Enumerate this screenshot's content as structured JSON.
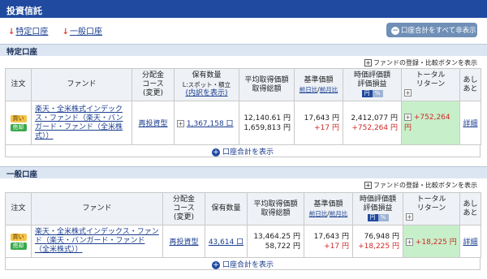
{
  "header": {
    "title": "投資信託"
  },
  "links": [
    {
      "label": "特定口座"
    },
    {
      "label": "一般口座"
    }
  ],
  "hide_all_button": {
    "label": "口座合計をすべて非表示"
  },
  "register_text": "ファンドの登録・比較ボタンを表示",
  "headers": {
    "order": "注文",
    "fund": "ファンド",
    "dist_1": "分配金",
    "dist_2": "コース",
    "dist_3": "(変更)",
    "qty_1": "保有数量",
    "qty_2": "L:スポット・積立",
    "qty_3": "(内訳を表示)",
    "qty_plain": "保有数量",
    "avg_1": "平均取得価額",
    "avg_2": "取得総額",
    "base_1": "基準価額",
    "base_prev_day": "前日比",
    "base_sep": "/",
    "base_prev_month": "前月比",
    "eval_1": "時価評価額",
    "eval_2": "評価損益",
    "yen_toggle": "円",
    "pct_toggle": "%",
    "total_1": "トータル",
    "total_2": "リターン",
    "ashi_1": "あし",
    "ashi_2": "あと"
  },
  "sections": [
    {
      "title": "特定口座",
      "row": {
        "buy_badge": "買い",
        "sell_badge": "売却",
        "fund_name": "楽天・全米株式インデックス・ファンド（楽天・バンガード・ファンド（全米株式））",
        "course": "再投資型",
        "quantity": "1,367,158 口",
        "avg_price": "12,140.61 円",
        "total_cost": "1,659,813 円",
        "base_price": "17,643 円",
        "base_change": "+17 円",
        "market_value": "2,412,077 円",
        "gain": "+752,264 円",
        "total_return": "+752,264 円",
        "detail": "詳細"
      },
      "footer": "口座合計を表示"
    },
    {
      "title": "一般口座",
      "row": {
        "buy_badge": "買い",
        "sell_badge": "売却",
        "fund_name": "楽天・全米株式インデックス・ファンド（楽天・バンガード・ファンド（全米株式））",
        "course": "再投資型",
        "quantity": "43,614 口",
        "avg_price": "13,464.25 円",
        "total_cost": "58,722 円",
        "base_price": "17,643 円",
        "base_change": "+17 円",
        "market_value": "76,948 円",
        "gain": "+18,225 円",
        "total_return": "+18,225 円",
        "detail": "詳細"
      },
      "footer": "口座合計を表示"
    }
  ],
  "colors": {
    "header_bg": "#1f4aa0",
    "section_bg": "#dce6f2",
    "return_bg": "#c7efc9",
    "gain_red": "#d02828"
  }
}
